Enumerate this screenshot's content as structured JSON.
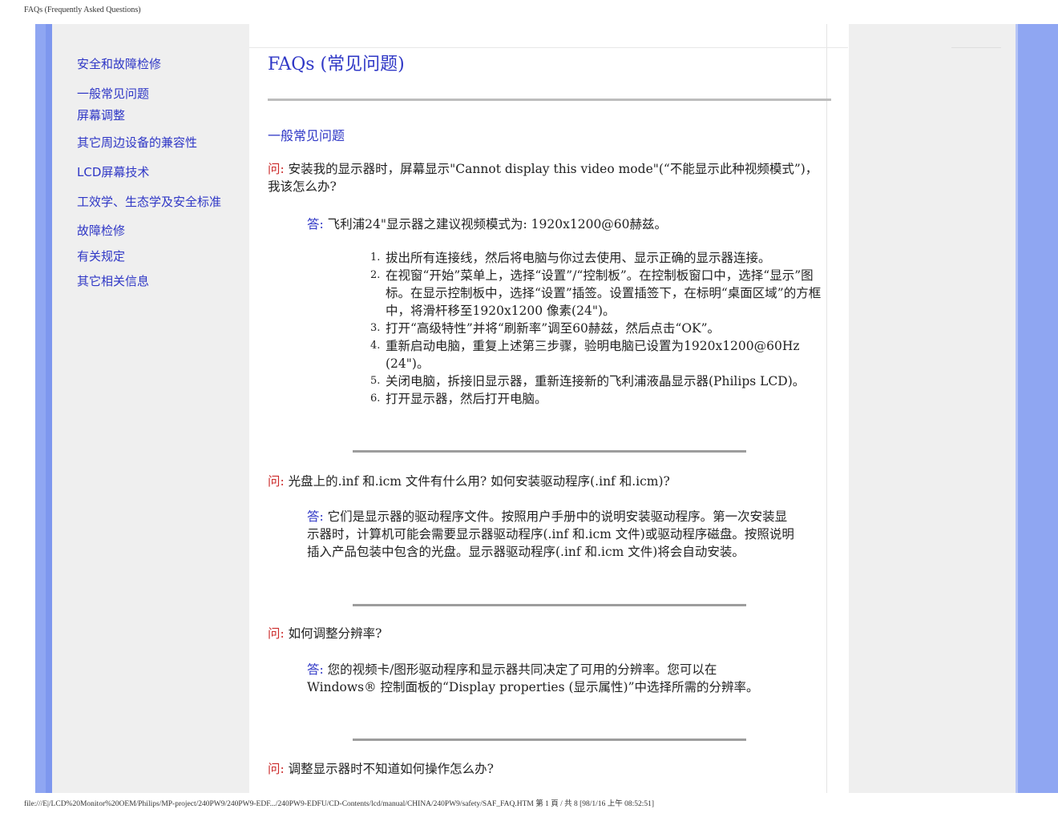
{
  "header": {
    "title": "FAQs (Frequently Asked Questions)"
  },
  "sidebar": {
    "items": [
      {
        "label": "安全和故障检修"
      },
      {
        "label": "一般常见问题"
      },
      {
        "label": "屏幕调整"
      },
      {
        "label": "其它周边设备的兼容性"
      },
      {
        "label": "LCD屏幕技术"
      },
      {
        "label": "工效学、生态学及安全标准"
      },
      {
        "label": "故障检修"
      },
      {
        "label": "有关规定"
      },
      {
        "label": "其它相关信息"
      }
    ]
  },
  "main": {
    "page_title": "FAQs (常见问题)",
    "section_title": "一般常见问题",
    "q_prefix": "问:",
    "a_prefix": "答:",
    "qa": [
      {
        "question": "安装我的显示器时，屏幕显示\"Cannot display this video mode\"(“不能显示此种视频模式”)，我该怎么办?",
        "answer": "飞利浦24\"显示器之建议视频模式为: 1920x1200@60赫兹。",
        "steps": [
          "拔出所有连接线，然后将电脑与你过去使用、显示正确的显示器连接。",
          "在视窗“开始”菜单上，选择“设置”/“控制板”。在控制板窗口中，选择“显示”图标。在显示控制板中，选择“设置”插签。设置插签下，在标明“桌面区域”的方框中，将滑杆移至1920x1200 像素(24\")。",
          "打开“高级特性”并将“刷新率”调至60赫兹，然后点击“OK”。",
          "重新启动电脑，重复上述第三步骤，验明电脑已设置为1920x1200@60Hz (24\")。",
          "关闭电脑，拆接旧显示器，重新连接新的飞利浦液晶显示器(Philips LCD)。",
          "打开显示器，然后打开电脑。"
        ]
      },
      {
        "question": "光盘上的.inf 和.icm 文件有什么用? 如何安装驱动程序(.inf 和.icm)?",
        "answer": "它们是显示器的驱动程序文件。按照用户手册中的说明安装驱动程序。第一次安装显示器时，计算机可能会需要显示器驱动程序(.inf 和.icm 文件)或驱动程序磁盘。按照说明插入产品包装中包含的光盘。显示器驱动程序(.inf 和.icm 文件)将会自动安装。"
      },
      {
        "question": "如何调整分辨率?",
        "answer": "您的视频卡/图形驱动程序和显示器共同决定了可用的分辨率。您可以在Windows® 控制面板的“Display properties (显示属性)”中选择所需的分辨率。"
      },
      {
        "question": "调整显示器时不知道如何操作怎么办?"
      }
    ]
  },
  "footer": {
    "path": "file:///E|/LCD%20Monitor%20OEM/Philips/MP-project/240PW9/240PW9-EDF.../240PW9-EDFU/CD-Contents/lcd/manual/CHINA/240PW9/safety/SAF_FAQ.HTM 第 1 頁 / 共 8 [98/1/16 上午 08:52:51]"
  },
  "colors": {
    "link": "#2f37c6",
    "question_mark": "#cc2b2b",
    "frame_blue": "#8fa6f2",
    "panel_gray": "#efefef"
  }
}
